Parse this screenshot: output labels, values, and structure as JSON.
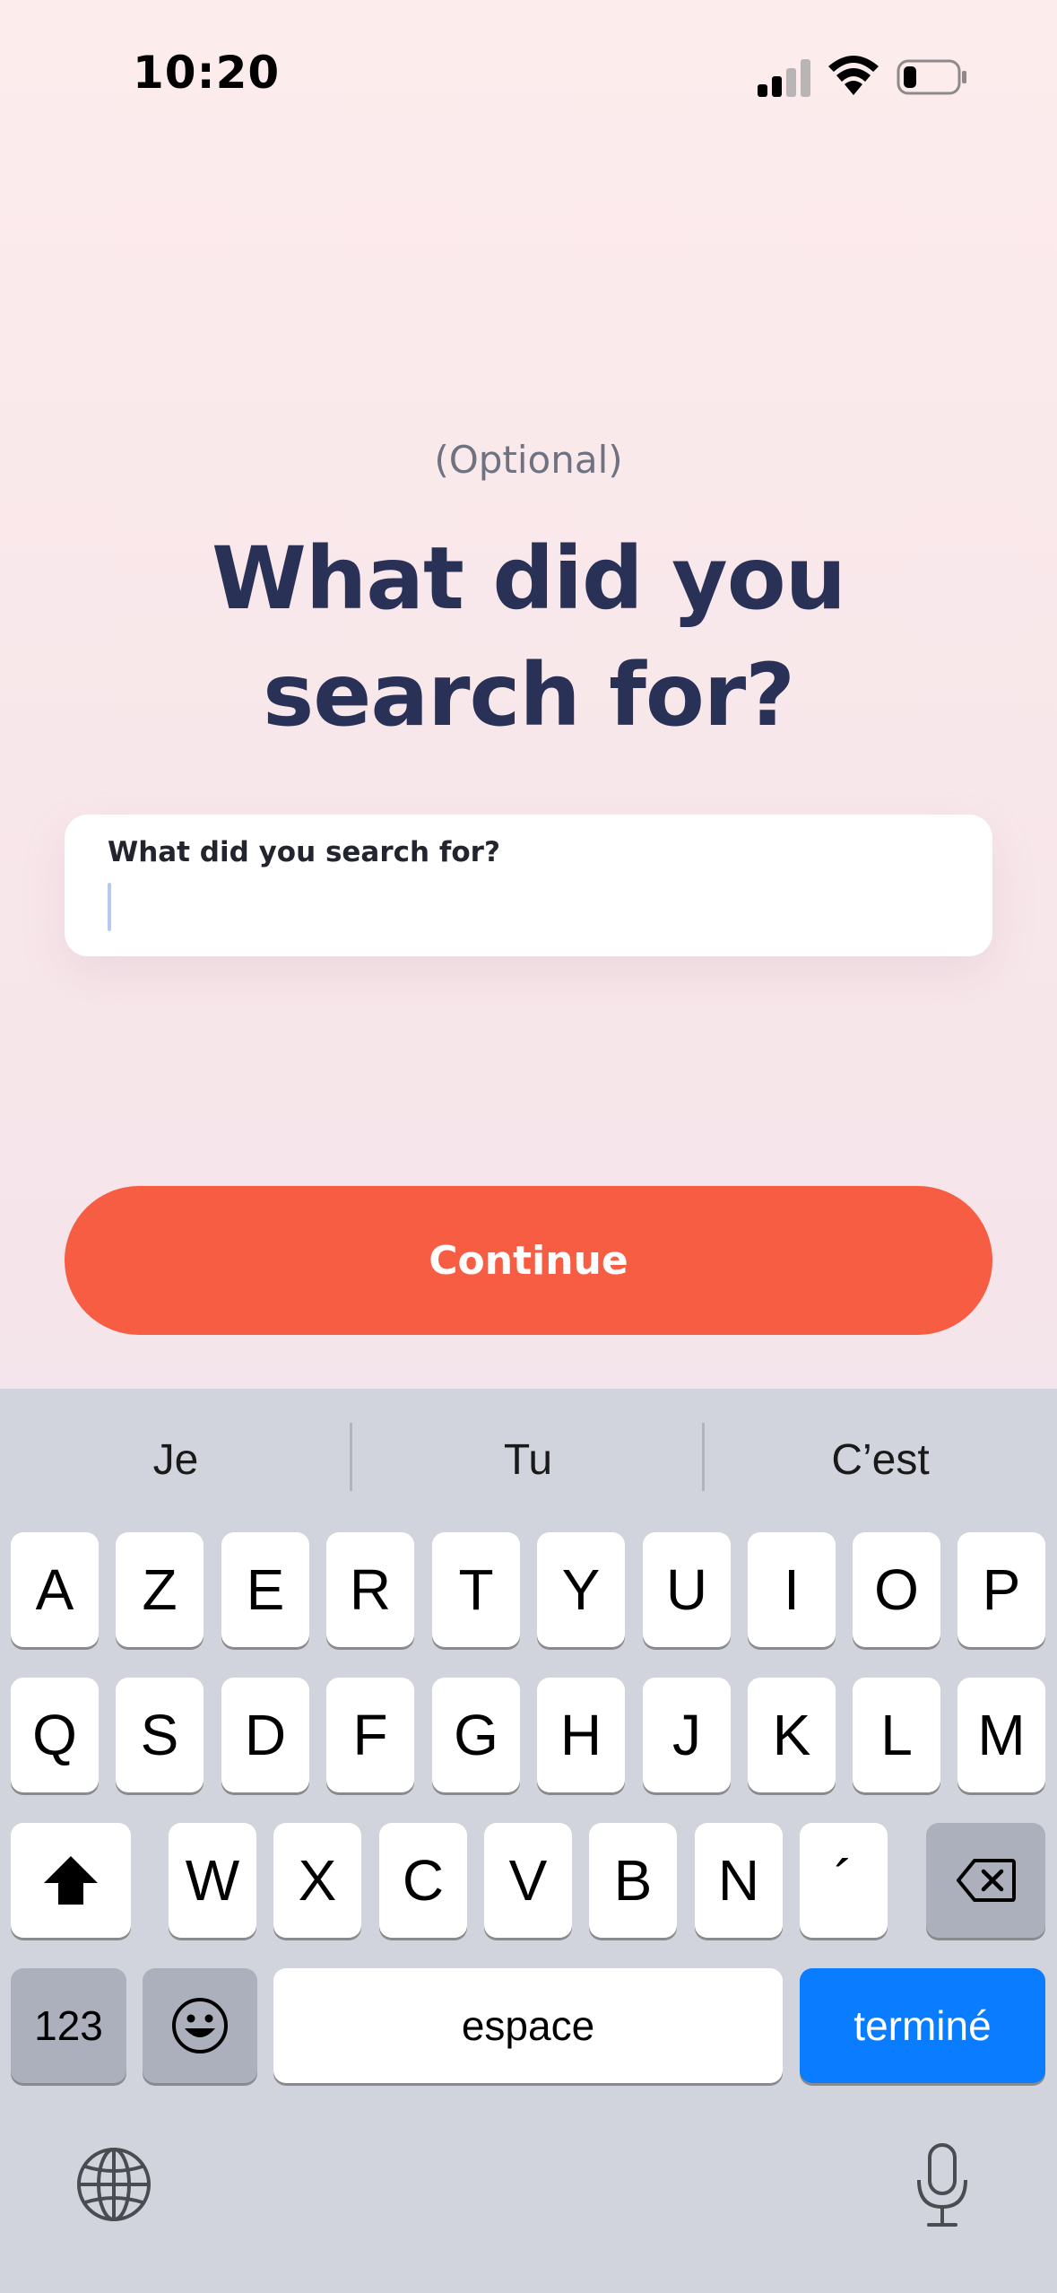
{
  "status_bar": {
    "time": "10:20"
  },
  "main": {
    "optional_label": "(Optional)",
    "title": "What did you search for?",
    "input": {
      "label": "What did you search for?",
      "value": ""
    },
    "continue_label": "Continue"
  },
  "keyboard": {
    "suggestions": [
      "Je",
      "Tu",
      "C’est"
    ],
    "row1": [
      "A",
      "Z",
      "E",
      "R",
      "T",
      "Y",
      "U",
      "I",
      "O",
      "P"
    ],
    "row2": [
      "Q",
      "S",
      "D",
      "F",
      "G",
      "H",
      "J",
      "K",
      "L",
      "M"
    ],
    "row3": [
      "W",
      "X",
      "C",
      "V",
      "B",
      "N",
      "´"
    ],
    "numbers_label": "123",
    "space_label": "espace",
    "done_label": "terminé"
  },
  "icons": {
    "signal": "cellular-signal-icon",
    "wifi": "wifi-icon",
    "battery": "battery-low-icon",
    "shift": "shift-icon",
    "delete": "backspace-icon",
    "emoji": "emoji-icon",
    "globe": "globe-icon",
    "mic": "microphone-icon"
  },
  "colors": {
    "accent": "#f65d43",
    "title": "#2a3157",
    "done_key": "#0a7cff"
  }
}
